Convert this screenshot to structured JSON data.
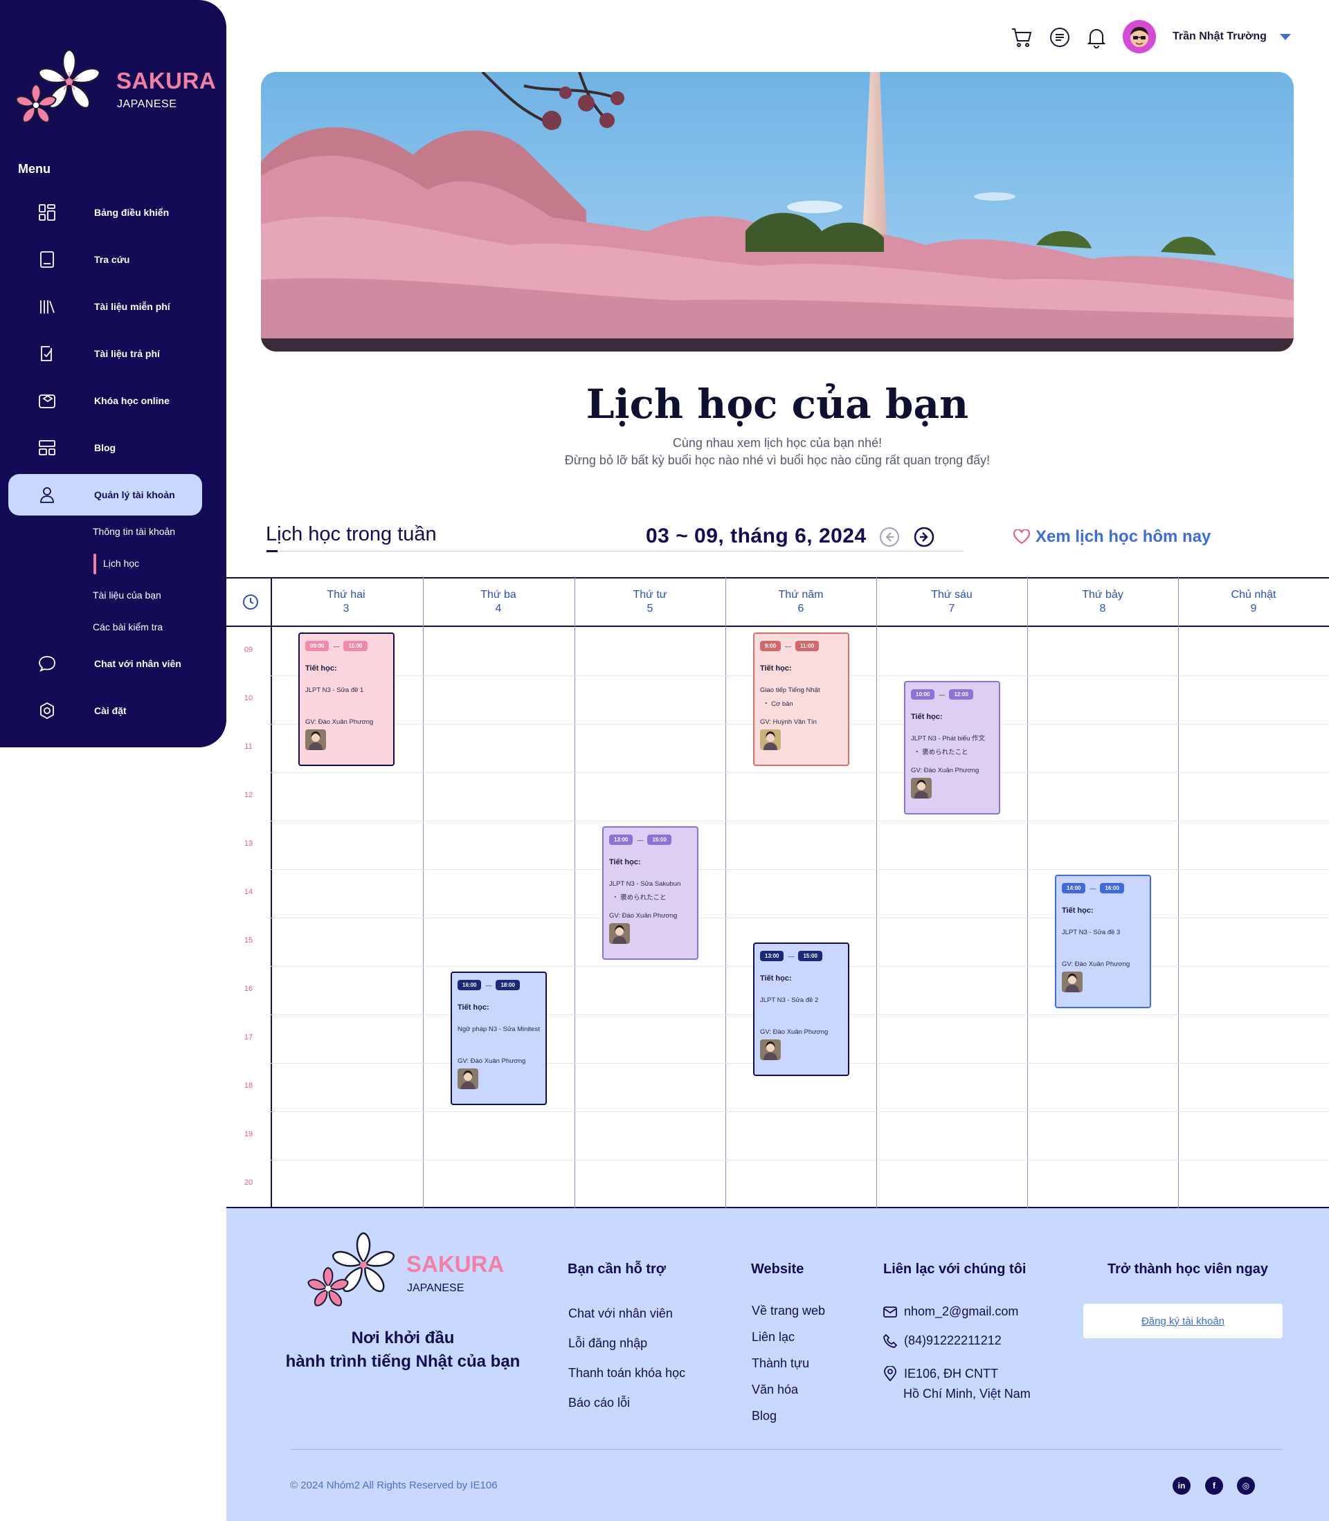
{
  "brand": {
    "name": "SAKURA",
    "sub": "JAPANESE"
  },
  "sidebar": {
    "menu_title": "Menu",
    "items": [
      {
        "label": "Bảng điều khiển",
        "icon": "dashboard-icon"
      },
      {
        "label": "Tra cứu",
        "icon": "book-icon"
      },
      {
        "label": "Tài liệu miễn phí",
        "icon": "library-icon"
      },
      {
        "label": "Tài liệu trả phí",
        "icon": "paid-doc-icon"
      },
      {
        "label": "Khóa học online",
        "icon": "online-course-icon"
      },
      {
        "label": "Blog",
        "icon": "blog-icon"
      },
      {
        "label": "Quản lý tài khoản",
        "icon": "user-icon"
      },
      {
        "label": "Chat với nhân viên",
        "icon": "chat-icon"
      },
      {
        "label": "Cài đặt",
        "icon": "settings-icon"
      }
    ],
    "sub_items": [
      {
        "label": "Thông tin tài khoản"
      },
      {
        "label": "Lịch học"
      },
      {
        "label": "Tài liệu của bạn"
      },
      {
        "label": "Các bài kiểm tra"
      }
    ],
    "active_color": "#c9d8ff"
  },
  "header": {
    "user_name": "Trần Nhật Trường"
  },
  "title": {
    "main": "Lịch học của bạn",
    "line1": "Cùng nhau xem lịch học của bạn nhé!",
    "line2": "Đừng bỏ lỡ bất kỳ buổi học nào nhé vì buổi học nào cũng rất quan trọng đấy!"
  },
  "week": {
    "title": "Lịch học trong tuần",
    "range": "03 ~ 09, tháng 6, 2024",
    "today_link": "Xem lịch học hôm nay"
  },
  "calendar": {
    "days": [
      {
        "name": "Thứ hai",
        "date": "3"
      },
      {
        "name": "Thứ ba",
        "date": "4"
      },
      {
        "name": "Thứ tư",
        "date": "5"
      },
      {
        "name": "Thứ năm",
        "date": "6"
      },
      {
        "name": "Thứ sáu",
        "date": "7"
      },
      {
        "name": "Thứ bảy",
        "date": "8"
      },
      {
        "name": "Chủ nhật",
        "date": "9"
      }
    ],
    "hours": [
      "09",
      "10",
      "11",
      "12",
      "13",
      "14",
      "15",
      "16",
      "17",
      "18",
      "19",
      "20"
    ],
    "events": [
      {
        "day": 0,
        "start": 9,
        "start_label": "09:00",
        "end_label": "11:00",
        "label": "Tiết học:",
        "subject": "JLPT N3 - Sửa đề 1",
        "teacher": "GV: Đào Xuân Phương",
        "theme": "pink",
        "chip": "#f08aa8"
      },
      {
        "day": 3,
        "start": 9,
        "start_label": "9:00",
        "end_label": "11:00",
        "label": "Tiết học:",
        "subject": "Giao tiếp Tiếng Nhật",
        "subject2": "・ Cơ bản",
        "teacher": "GV: Huỳnh Văn Tín",
        "theme": "red",
        "chip": "#d06a6a"
      },
      {
        "day": 4,
        "start": 10,
        "start_label": "10:00",
        "end_label": "12:00",
        "label": "Tiết học:",
        "subject": "JLPT N3 - Phát biểu 作文",
        "subject2": "・ 褒められたこと",
        "teacher": "GV: Đào Xuân Phương",
        "theme": "purple",
        "chip": "#8c72d9"
      },
      {
        "day": 2,
        "start": 13,
        "start_label": "13:00",
        "end_label": "15:00",
        "label": "Tiết học:",
        "subject": "JLPT N3 - Sửa Sakubun",
        "subject2": "・ 褒められたこと",
        "teacher": "GV: Đào Xuân Phương",
        "theme": "purple",
        "chip": "#8c72d9"
      },
      {
        "day": 5,
        "start": 14,
        "start_label": "14:00",
        "end_label": "16:00",
        "label": "Tiết học:",
        "subject": "JLPT N3 - Sửa đề 3",
        "teacher": "GV: Đào Xuân Phương",
        "theme": "blue",
        "chip": "#4169e0"
      },
      {
        "day": 3,
        "start": 15.4,
        "start_label": "13:00",
        "end_label": "15:00",
        "label": "Tiết học:",
        "subject": "JLPT N3 - Sửa đề  2",
        "teacher": "GV: Đào Xuân Phương",
        "theme": "navy",
        "chip": "#1a2a7a"
      },
      {
        "day": 1,
        "start": 16,
        "start_label": "16:00",
        "end_label": "18:00",
        "label": "Tiết học:",
        "subject": "Ngữ pháp N3 - Sửa Minitest",
        "teacher": "GV: Đào Xuân Phương",
        "theme": "navy",
        "chip": "#1a2a7a"
      }
    ]
  },
  "footer": {
    "slogan1": "Nơi khởi đầu",
    "slogan2": "hành trình tiếng Nhật của bạn",
    "support": {
      "title": "Bạn cần hỗ trợ",
      "links": [
        "Chat với nhân viên",
        "Lỗi đăng nhập",
        "Thanh toán khóa học",
        "Báo cáo lỗi"
      ]
    },
    "website": {
      "title": "Website",
      "links": [
        "Về trang web",
        "Liên lạc",
        "Thành tựu",
        "Văn hóa",
        "Blog"
      ]
    },
    "contact": {
      "title": "Liên lạc với chúng tôi",
      "email": "nhom_2@gmail.com",
      "phone": "(84)91222211212",
      "address1": "IE106, ĐH CNTT",
      "address2": "Hồ Chí Minh, Việt Nam"
    },
    "register": {
      "title": "Trở thành học viên ngay",
      "button": "Đăng ký tài khoản"
    },
    "copyright": "© 2024 Nhóm2 All Rights Reserved by IE106",
    "social": [
      {
        "icon": "linkedin-icon",
        "glyph": "in"
      },
      {
        "icon": "facebook-icon",
        "glyph": "f"
      },
      {
        "icon": "instagram-icon",
        "glyph": "◎"
      }
    ]
  },
  "colors": {
    "navy": "#130b56",
    "pink": "#f27fa4",
    "accent_blue": "#3b6de0",
    "footer_bg": "#c9d8ff"
  }
}
